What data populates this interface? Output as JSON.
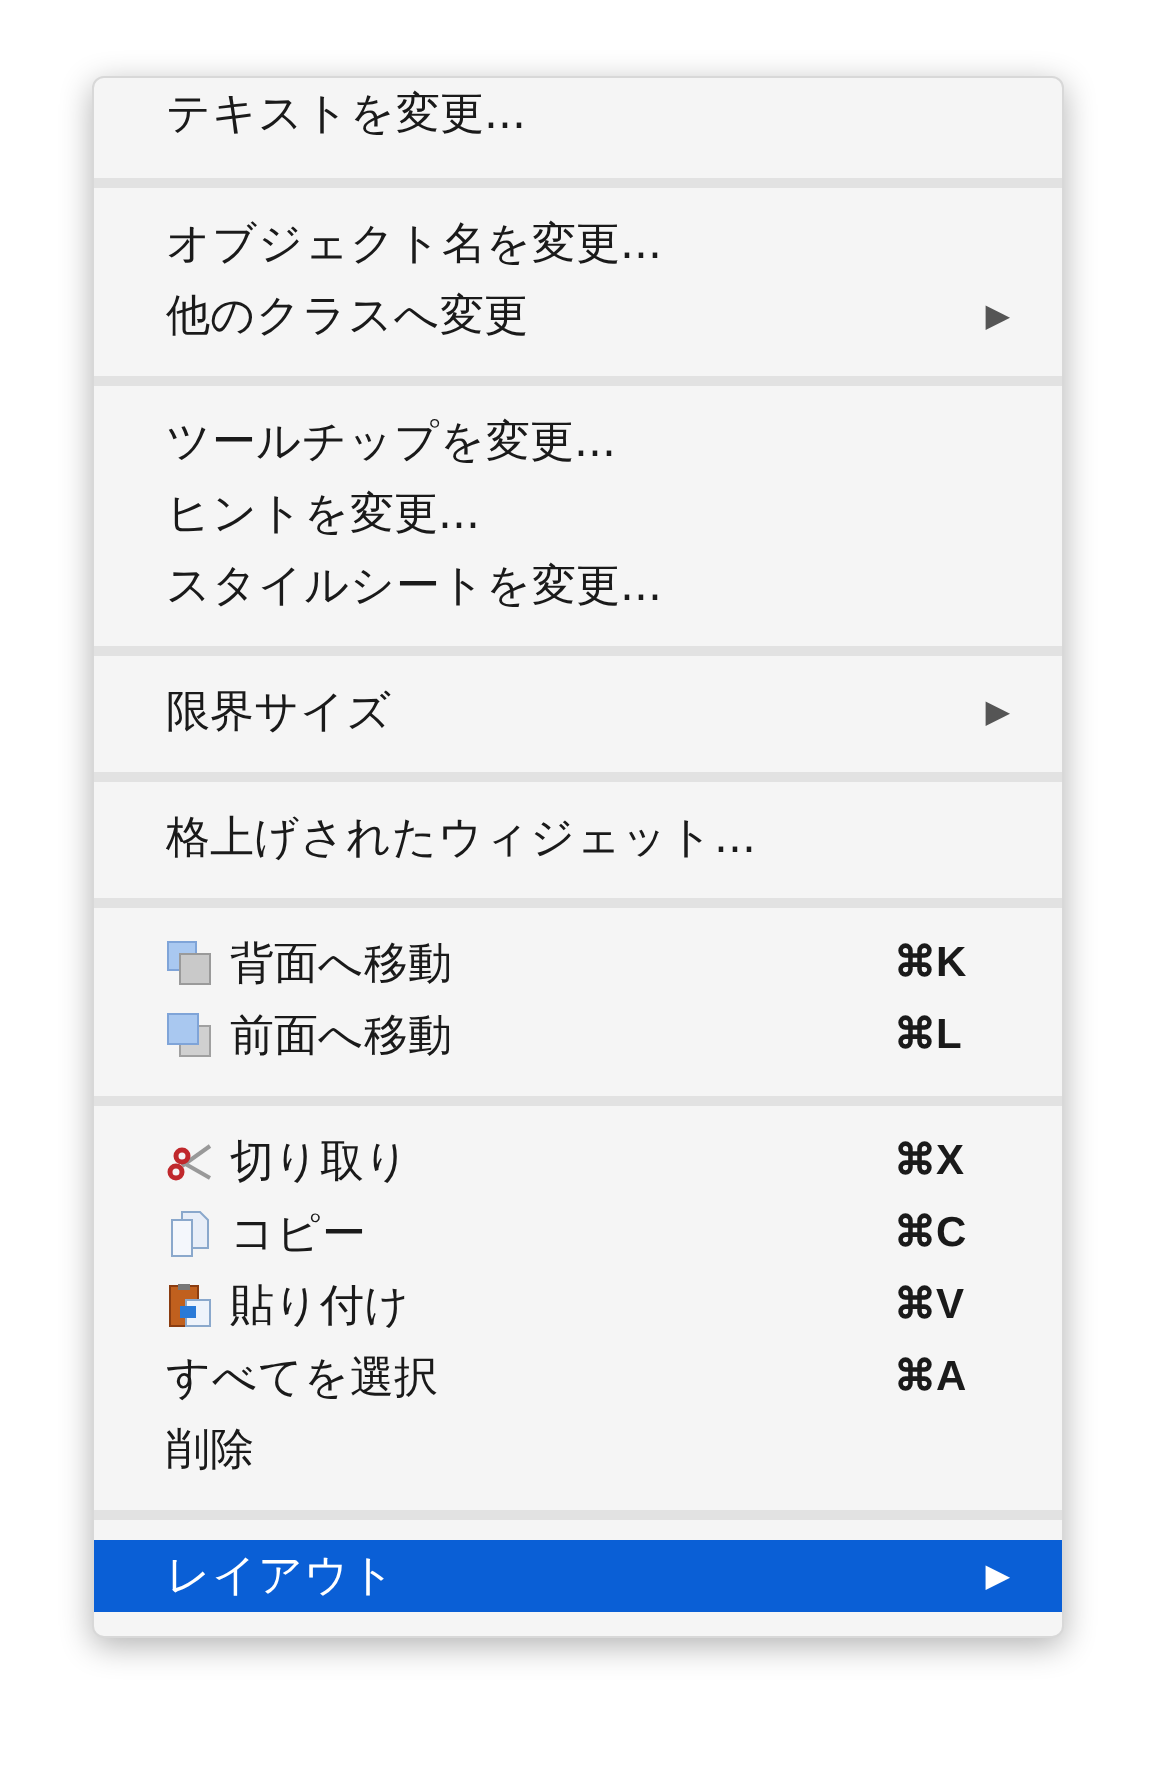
{
  "menu": {
    "groups": [
      {
        "items": [
          {
            "label": "テキストを変更...",
            "kind": "plain",
            "selected": false
          }
        ]
      },
      {
        "items": [
          {
            "label": "オブジェクト名を変更...",
            "kind": "plain",
            "selected": false
          },
          {
            "label": "他のクラスへ変更",
            "kind": "plain",
            "arrow": "▶",
            "selected": false
          }
        ]
      },
      {
        "items": [
          {
            "label": "ツールチップを変更...",
            "kind": "plain",
            "selected": false
          },
          {
            "label": "ヒントを変更...",
            "kind": "plain",
            "selected": false
          },
          {
            "label": "スタイルシートを変更...",
            "kind": "plain",
            "selected": false
          }
        ]
      },
      {
        "items": [
          {
            "label": "限界サイズ",
            "kind": "plain",
            "arrow": "▶",
            "selected": false
          }
        ]
      },
      {
        "items": [
          {
            "label": "格上げされたウィジェット...",
            "kind": "plain",
            "selected": false
          }
        ]
      },
      {
        "items": [
          {
            "label": "背面へ移動",
            "kind": "send-back",
            "shortcut": "⌘K",
            "selected": false
          },
          {
            "label": "前面へ移動",
            "kind": "bring-front",
            "shortcut": "⌘L",
            "selected": false
          }
        ]
      },
      {
        "items": [
          {
            "label": "切り取り",
            "kind": "cut",
            "shortcut": "⌘X",
            "selected": false
          },
          {
            "label": "コピー",
            "kind": "copy",
            "shortcut": "⌘C",
            "selected": false
          },
          {
            "label": "貼り付け",
            "kind": "paste",
            "shortcut": "⌘V",
            "selected": false
          },
          {
            "label": "すべてを選択",
            "kind": "plain",
            "shortcut": "⌘A",
            "selected": false
          },
          {
            "label": "削除",
            "kind": "plain",
            "selected": false
          }
        ]
      },
      {
        "items": [
          {
            "label": "レイアウト",
            "kind": "plain",
            "arrow": "▶",
            "selected": true
          }
        ]
      }
    ]
  }
}
